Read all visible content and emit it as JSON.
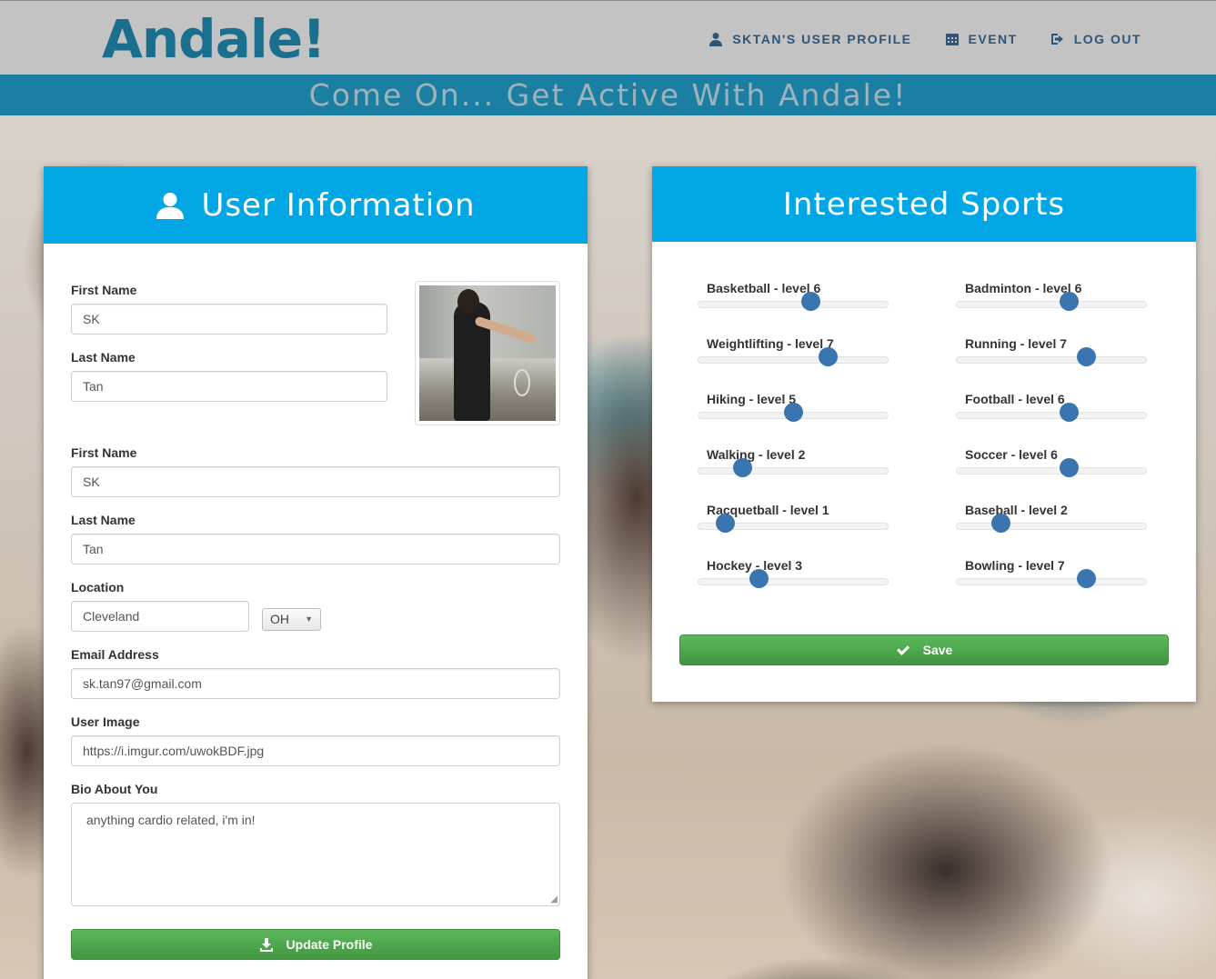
{
  "app": {
    "logo": "Andale!"
  },
  "nav": [
    {
      "label": "SKTAN's USER PROFILE",
      "icon": "user-icon"
    },
    {
      "label": "EVENT",
      "icon": "calendar-icon"
    },
    {
      "label": "LOG OUT",
      "icon": "logout-icon"
    }
  ],
  "banner": {
    "text": "Come On... Get Active With Andale!"
  },
  "user_panel": {
    "title": "User Information",
    "top_first_name_label": "First Name",
    "top_first_name_value": "SK",
    "top_last_name_label": "Last Name",
    "top_last_name_value": "Tan",
    "first_name_label": "First Name",
    "first_name_value": "SK",
    "last_name_label": "Last Name",
    "last_name_value": "Tan",
    "location_label": "Location",
    "city_value": "Cleveland",
    "state_value": "OH",
    "email_label": "Email Address",
    "email_value": "sk.tan97@gmail.com",
    "image_label": "User Image",
    "image_value": "https://i.imgur.com/uwokBDF.jpg",
    "bio_label": "Bio About You",
    "bio_value": "anything cardio related, i'm in!",
    "update_button": "Update Profile"
  },
  "sports_panel": {
    "title": "Interested Sports",
    "max_level": 10,
    "sports": [
      {
        "label": "Basketball - level 6",
        "level": 6
      },
      {
        "label": "Badminton - level 6",
        "level": 6
      },
      {
        "label": "Weightlifting - level 7",
        "level": 7
      },
      {
        "label": "Running - level 7",
        "level": 7
      },
      {
        "label": "Hiking - level 5",
        "level": 5
      },
      {
        "label": "Football - level 6",
        "level": 6
      },
      {
        "label": "Walking - level 2",
        "level": 2
      },
      {
        "label": "Soccer - level 6",
        "level": 6
      },
      {
        "label": "Racquetball - level 1",
        "level": 1
      },
      {
        "label": "Baseball - level 2",
        "level": 2
      },
      {
        "label": "Hockey - level 3",
        "level": 3
      },
      {
        "label": "Bowling - level 7",
        "level": 7
      }
    ],
    "save_button": "Save"
  },
  "colors": {
    "accent": "#00a7e4",
    "banner": "#1b7fa3",
    "logo": "#1a6f8e",
    "button_green": "#4cae4c",
    "slider_thumb": "#3a75b0"
  }
}
